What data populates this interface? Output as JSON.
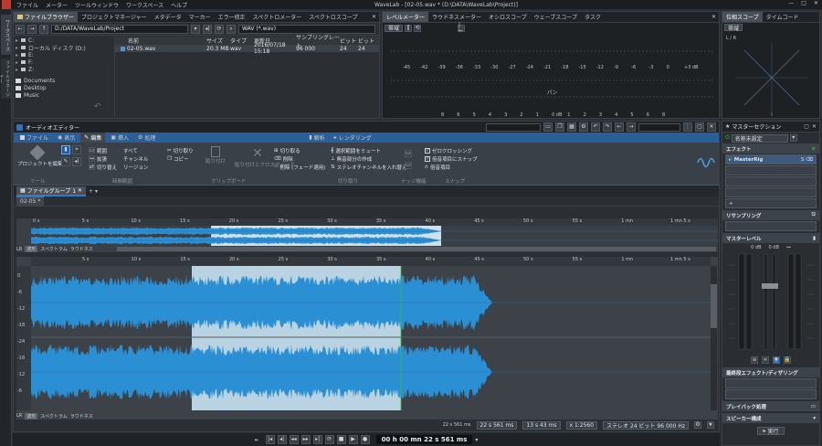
{
  "app": {
    "title": "WaveLab - [02-05.wav * (D:\\DATA\\WaveLab\\Project)]",
    "menu": [
      "ファイル",
      "メーター",
      "ツールウィンドウ",
      "ワークスペース",
      "ヘルプ"
    ]
  },
  "vtabs": [
    "ワークスペース",
    "ファイルマネージャー"
  ],
  "top_left": {
    "tabs": [
      "ファイルブラウザー",
      "プロジェクトマネージャー",
      "メタデータ",
      "マーカー",
      "エラー修正",
      "スペクトロメーター",
      "スペクトロスコープ"
    ],
    "path": "D:/DATA/WaveLab/Project",
    "filter": "WAV (*.wav)",
    "tree": [
      "C:",
      "ローカル ディスク (D:)",
      "E:",
      "F:",
      "Z:"
    ],
    "folders": [
      "Documents",
      "Desktop",
      "Music"
    ],
    "columns": [
      "名前",
      "サイズ",
      "タイプ",
      "更新日",
      "サンプリングレート",
      "ビット",
      "ビット"
    ],
    "rows": [
      [
        "02-05.wav",
        "20.3 MB",
        "wav",
        "2016/07/18 15:18",
        "96 000",
        "24",
        "24"
      ]
    ]
  },
  "meter": {
    "tabs": [
      "レベルメーター",
      "ラウドネスメーター",
      "オシロスコープ",
      "ウェーブスコープ",
      "タスク"
    ],
    "mode": "帯域",
    "scale": [
      "-45",
      "-42",
      "-39",
      "-36",
      "-33",
      "-30",
      "-27",
      "-24",
      "-21",
      "-18",
      "-15",
      "-12",
      "-9",
      "-6",
      "-3",
      "0",
      "+3 dB"
    ],
    "pan_label": "パン",
    "bottom_scale": [
      "8",
      "6",
      "5",
      "4",
      "3",
      "2",
      "1",
      "0 dB",
      "1",
      "2",
      "3",
      "4",
      "5",
      "6",
      "8"
    ]
  },
  "right_top": {
    "tabs": [
      "位相スコープ",
      "タイムコード"
    ],
    "mode": "帯域",
    "scale_label": "L / R"
  },
  "editor": {
    "title": "オーディオエディター",
    "ribbon_tabs": [
      "ファイル",
      "表示",
      "編集",
      "挿入",
      "処理",
      "解析",
      "レンダリング"
    ],
    "ribbon": {
      "tool_main": "プロジェクトを編集",
      "tool_group": "ツール",
      "select": [
        "範囲",
        "拡張",
        "切り替え"
      ],
      "select2": [
        "すべて",
        "チャンネル",
        "リージョン"
      ],
      "select_group": "時間範囲",
      "clip": [
        "切り取り",
        "コピー",
        "貼り付け",
        "貼り付けとクロスフェード"
      ],
      "clip_group": "クリップボード",
      "cut": [
        "切り取る",
        "削除",
        "削除 (フェード適用)"
      ],
      "cut2": [
        "選択範囲をミュート",
        "無音部分の作成",
        "ステレオチャンネルを入れ替え"
      ],
      "cut_group": "切り取り",
      "ext_group": "ナッジ機能",
      "snap": [
        "ゼロクロッシング",
        "倍音項目にスナップ",
        "倍音項目"
      ],
      "snap_group": "スナップ"
    },
    "group_tab": "ファイルグループ 1",
    "file_tab": "02-05 *",
    "overview_ticks": [
      "0 s",
      "5 s",
      "10 s",
      "15 s",
      "20 s",
      "25 s",
      "30 s",
      "35 s",
      "40 s",
      "45 s",
      "50 s",
      "55 s",
      "1 mn",
      "1 mn 5 s"
    ],
    "main_ticks": [
      "5 s",
      "10 s",
      "15 s",
      "20 s",
      "25 s",
      "30 s",
      "35 s",
      "40 s",
      "45 s",
      "50 s",
      "55 s",
      "1 mn",
      "1 mn 5 s"
    ],
    "view_tabs": [
      "波形",
      "スペクトラム",
      "ラウドネス"
    ],
    "db_labels": [
      "0",
      "-6",
      "-12",
      "-18",
      "-24",
      "-18",
      "-12",
      "-6"
    ],
    "status": {
      "cursor": "22 s 561 ms",
      "sel_start": "22 s 561 ms",
      "sel_len": "13 s 43 ms",
      "zoom": "x 1:2560",
      "format": "ステレオ 24 ビット 96 000 Hz"
    },
    "transport_time": "00 h 00 mn 22 s 561 ms"
  },
  "master": {
    "title": "マスターセクション",
    "preset": "名称未設定",
    "effects_label": "エフェクト",
    "plugin": "MasterRig",
    "resampling_label": "リサンプリング",
    "level_label": "マスターレベル",
    "level_values": [
      "0 dB",
      "0 dB"
    ],
    "final_label": "最終段エフェクト/ディザリング",
    "playback_label": "プレイバック処理",
    "speaker_label": "スピーカー構成",
    "render_label": "実行"
  },
  "colors": {
    "accent": "#2f7ad0",
    "wave": "#2b8fd3",
    "wave_sel": "#1e5d95",
    "selection": "#b9d3e3",
    "green": "#3fbf3f"
  }
}
